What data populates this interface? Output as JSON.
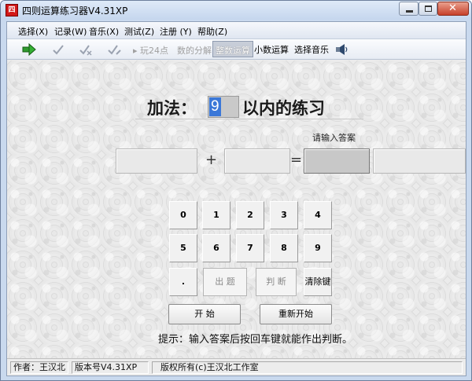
{
  "window": {
    "title": "四则运算练习器V4.31XP",
    "icon_text": "四"
  },
  "menu": [
    {
      "label": "选择(X)"
    },
    {
      "label": "记录(W)"
    },
    {
      "label": "音乐(X)"
    },
    {
      "label": "测试(Z)"
    },
    {
      "label": "注册 (Y)"
    },
    {
      "label": "帮助(Z)"
    }
  ],
  "toolbar": {
    "play24": "玩24点",
    "decompose": "数的分解",
    "integer_op": "整数运算",
    "decimal_op": "小数运算",
    "choose_music": "选择音乐"
  },
  "exercise": {
    "operation_label": "加法：",
    "range_value": "9",
    "suffix_label": "以内的练习",
    "answer_prompt": "请输入答案",
    "plus_sign": "+",
    "equals_sign": "=",
    "operand1": "",
    "operand2": "",
    "answer": "",
    "extra": ""
  },
  "keypad": {
    "row1": [
      "0",
      "1",
      "2",
      "3",
      "4"
    ],
    "row2": [
      "5",
      "6",
      "7",
      "8",
      "9"
    ],
    "dot": ".",
    "question": "出 题",
    "judge": "判 断",
    "clear": "清除键"
  },
  "buttons": {
    "start": "开 始",
    "restart": "重新开始"
  },
  "hint": "提示：输入答案后按回车键就能作出判断。",
  "status": {
    "author": "作者：王汉北",
    "version": "版本号V4.31XP",
    "copyright": "版权所有(c)王汉北工作室"
  },
  "icons": [
    "green-arrow-icon",
    "check-icon",
    "check-cross-icon",
    "check-pen-icon",
    "speaker-icon"
  ]
}
